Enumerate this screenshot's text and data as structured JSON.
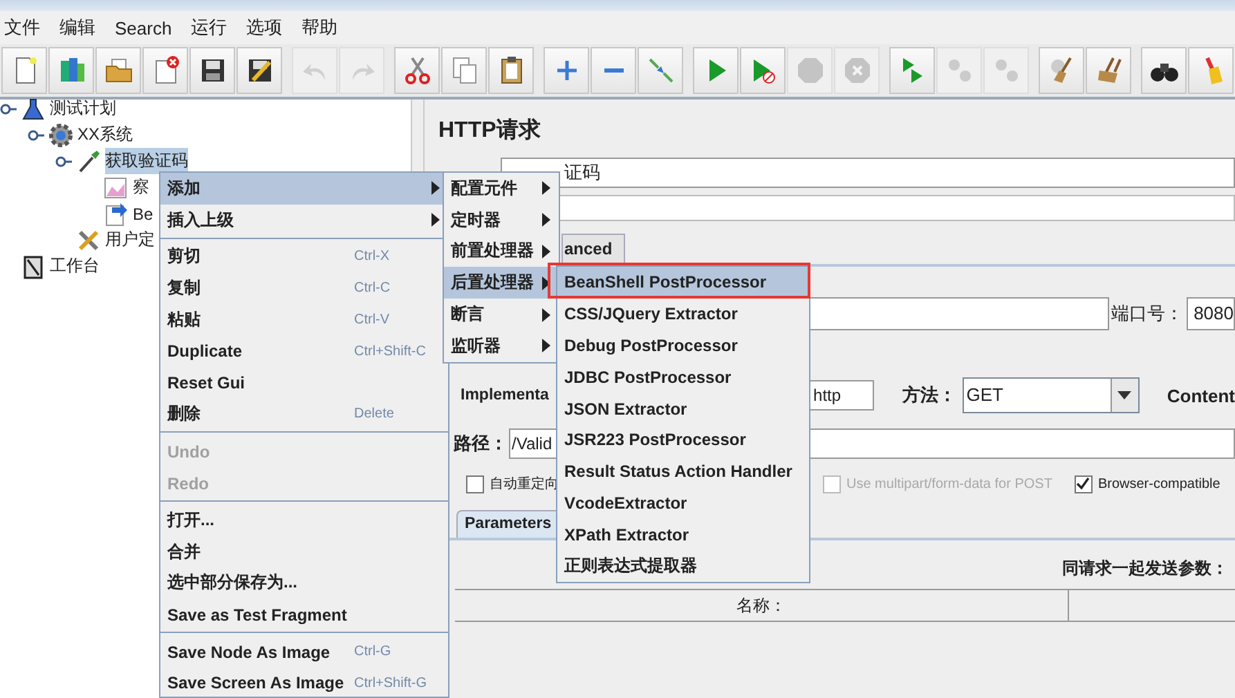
{
  "menu_bar": [
    "文件",
    "编辑",
    "Search",
    "运行",
    "选项",
    "帮助"
  ],
  "toolbar": [
    {
      "kind": "new",
      "disabled": false
    },
    {
      "kind": "templates",
      "disabled": false
    },
    {
      "kind": "open",
      "disabled": false
    },
    {
      "kind": "close",
      "disabled": false
    },
    {
      "kind": "save",
      "disabled": false
    },
    {
      "kind": "saveas",
      "disabled": false
    },
    {
      "kind": "separator"
    },
    {
      "kind": "undo",
      "disabled": true
    },
    {
      "kind": "redo",
      "disabled": true
    },
    {
      "kind": "separator"
    },
    {
      "kind": "cut",
      "disabled": false
    },
    {
      "kind": "copy",
      "disabled": false
    },
    {
      "kind": "paste",
      "disabled": false
    },
    {
      "kind": "separator"
    },
    {
      "kind": "expand",
      "disabled": false
    },
    {
      "kind": "collapse",
      "disabled": false
    },
    {
      "kind": "toggle",
      "disabled": false
    },
    {
      "kind": "separator"
    },
    {
      "kind": "start",
      "disabled": false
    },
    {
      "kind": "startnp",
      "disabled": false
    },
    {
      "kind": "stop",
      "disabled": true
    },
    {
      "kind": "shutdown",
      "disabled": true
    },
    {
      "kind": "separator"
    },
    {
      "kind": "rstart",
      "disabled": false
    },
    {
      "kind": "rstop",
      "disabled": true
    },
    {
      "kind": "rshut",
      "disabled": true
    },
    {
      "kind": "separator"
    },
    {
      "kind": "clear",
      "disabled": false
    },
    {
      "kind": "clearall",
      "disabled": false
    },
    {
      "kind": "separator"
    },
    {
      "kind": "search",
      "disabled": false
    },
    {
      "kind": "reset",
      "disabled": false
    }
  ],
  "tree": [
    {
      "label": "测试计划",
      "kind": "plan",
      "selected": false,
      "children": [
        {
          "label": "XX系统",
          "kind": "thread",
          "selected": false,
          "children": [
            {
              "label": "获取验证码",
              "kind": "sampler",
              "selected": true,
              "children": [
                {
                  "label": "察",
                  "kind": "listener",
                  "selected": false
                },
                {
                  "label": "Be",
                  "kind": "postprocessor",
                  "selected": false
                }
              ]
            },
            {
              "label": "用户定",
              "kind": "config",
              "selected": false
            }
          ]
        }
      ]
    },
    {
      "label": "工作台",
      "kind": "workbench",
      "selected": false
    }
  ],
  "http_panel": {
    "title": "HTTP请求",
    "name_value": "证码",
    "advanced_tab": {
      "label": "anced",
      "selected": false
    },
    "port_label": "端口号：",
    "port_value": "8080",
    "implementation_label": "Implementa",
    "protocol_value": "http",
    "method_label": "方法：",
    "method_value": "GET",
    "content_label": "Content",
    "path_label": "路径：",
    "path_value": "/Valid",
    "checkboxes": [
      {
        "label": "自动重定向",
        "checked": false,
        "disabled": false
      },
      {
        "label": "Use multipart/form-data for POST",
        "checked": false,
        "disabled": true
      },
      {
        "label": "Browser-compatible",
        "checked": true,
        "disabled": false
      }
    ],
    "parameters_tab": {
      "label": "Parameters",
      "selected": true
    },
    "parameters_caption": "同请求一起发送参数：",
    "table_columns": [
      "名称："
    ]
  },
  "context_menu": [
    {
      "kind": "item",
      "label": "添加",
      "submenu": true,
      "selected": true,
      "disabled": false
    },
    {
      "kind": "item",
      "label": "插入上级",
      "submenu": true,
      "selected": false,
      "disabled": false
    },
    {
      "kind": "separator"
    },
    {
      "kind": "item",
      "label": "剪切",
      "shortcut": "Ctrl-X",
      "submenu": false,
      "selected": false,
      "disabled": false
    },
    {
      "kind": "item",
      "label": "复制",
      "shortcut": "Ctrl-C",
      "submenu": false,
      "selected": false,
      "disabled": false
    },
    {
      "kind": "item",
      "label": "粘贴",
      "shortcut": "Ctrl-V",
      "submenu": false,
      "selected": false,
      "disabled": false
    },
    {
      "kind": "item",
      "label": "Duplicate",
      "shortcut": "Ctrl+Shift-C",
      "submenu": false,
      "selected": false,
      "disabled": false
    },
    {
      "kind": "item",
      "label": "Reset Gui",
      "submenu": false,
      "selected": false,
      "disabled": false
    },
    {
      "kind": "item",
      "label": "删除",
      "shortcut": "Delete",
      "submenu": false,
      "selected": false,
      "disabled": false
    },
    {
      "kind": "separator"
    },
    {
      "kind": "item",
      "label": "Undo",
      "submenu": false,
      "selected": false,
      "disabled": true
    },
    {
      "kind": "item",
      "label": "Redo",
      "submenu": false,
      "selected": false,
      "disabled": true
    },
    {
      "kind": "separator"
    },
    {
      "kind": "item",
      "label": "打开...",
      "submenu": false,
      "selected": false,
      "disabled": false
    },
    {
      "kind": "item",
      "label": "合并",
      "submenu": false,
      "selected": false,
      "disabled": false
    },
    {
      "kind": "item",
      "label": "选中部分保存为...",
      "submenu": false,
      "selected": false,
      "disabled": false
    },
    {
      "kind": "item",
      "label": "Save as Test Fragment",
      "submenu": false,
      "selected": false,
      "disabled": false
    },
    {
      "kind": "separator"
    },
    {
      "kind": "item",
      "label": "Save Node As Image",
      "shortcut": "Ctrl-G",
      "submenu": false,
      "selected": false,
      "disabled": false
    },
    {
      "kind": "item",
      "label": "Save Screen As Image",
      "shortcut": "Ctrl+Shift-G",
      "submenu": false,
      "selected": false,
      "disabled": false
    }
  ],
  "add_submenu": [
    {
      "label": "配置元件",
      "submenu": true,
      "selected": false
    },
    {
      "label": "定时器",
      "submenu": true,
      "selected": false
    },
    {
      "label": "前置处理器",
      "submenu": true,
      "selected": false
    },
    {
      "label": "后置处理器",
      "submenu": true,
      "selected": true
    },
    {
      "label": "断言",
      "submenu": true,
      "selected": false
    },
    {
      "label": "监听器",
      "submenu": true,
      "selected": false
    }
  ],
  "postprocessor_submenu": [
    {
      "label": "BeanShell PostProcessor",
      "selected": true,
      "highlighted": true
    },
    {
      "label": "CSS/JQuery Extractor",
      "selected": false,
      "highlighted": false
    },
    {
      "label": "Debug PostProcessor",
      "selected": false,
      "highlighted": false
    },
    {
      "label": "JDBC PostProcessor",
      "selected": false,
      "highlighted": false
    },
    {
      "label": "JSON Extractor",
      "selected": false,
      "highlighted": false
    },
    {
      "label": "JSR223 PostProcessor",
      "selected": false,
      "highlighted": false
    },
    {
      "label": "Result Status Action Handler",
      "selected": false,
      "highlighted": false
    },
    {
      "label": "VcodeExtractor",
      "selected": false,
      "highlighted": false
    },
    {
      "label": "XPath Extractor",
      "selected": false,
      "highlighted": false
    },
    {
      "label": "正则表达式提取器",
      "selected": false,
      "highlighted": false
    }
  ]
}
